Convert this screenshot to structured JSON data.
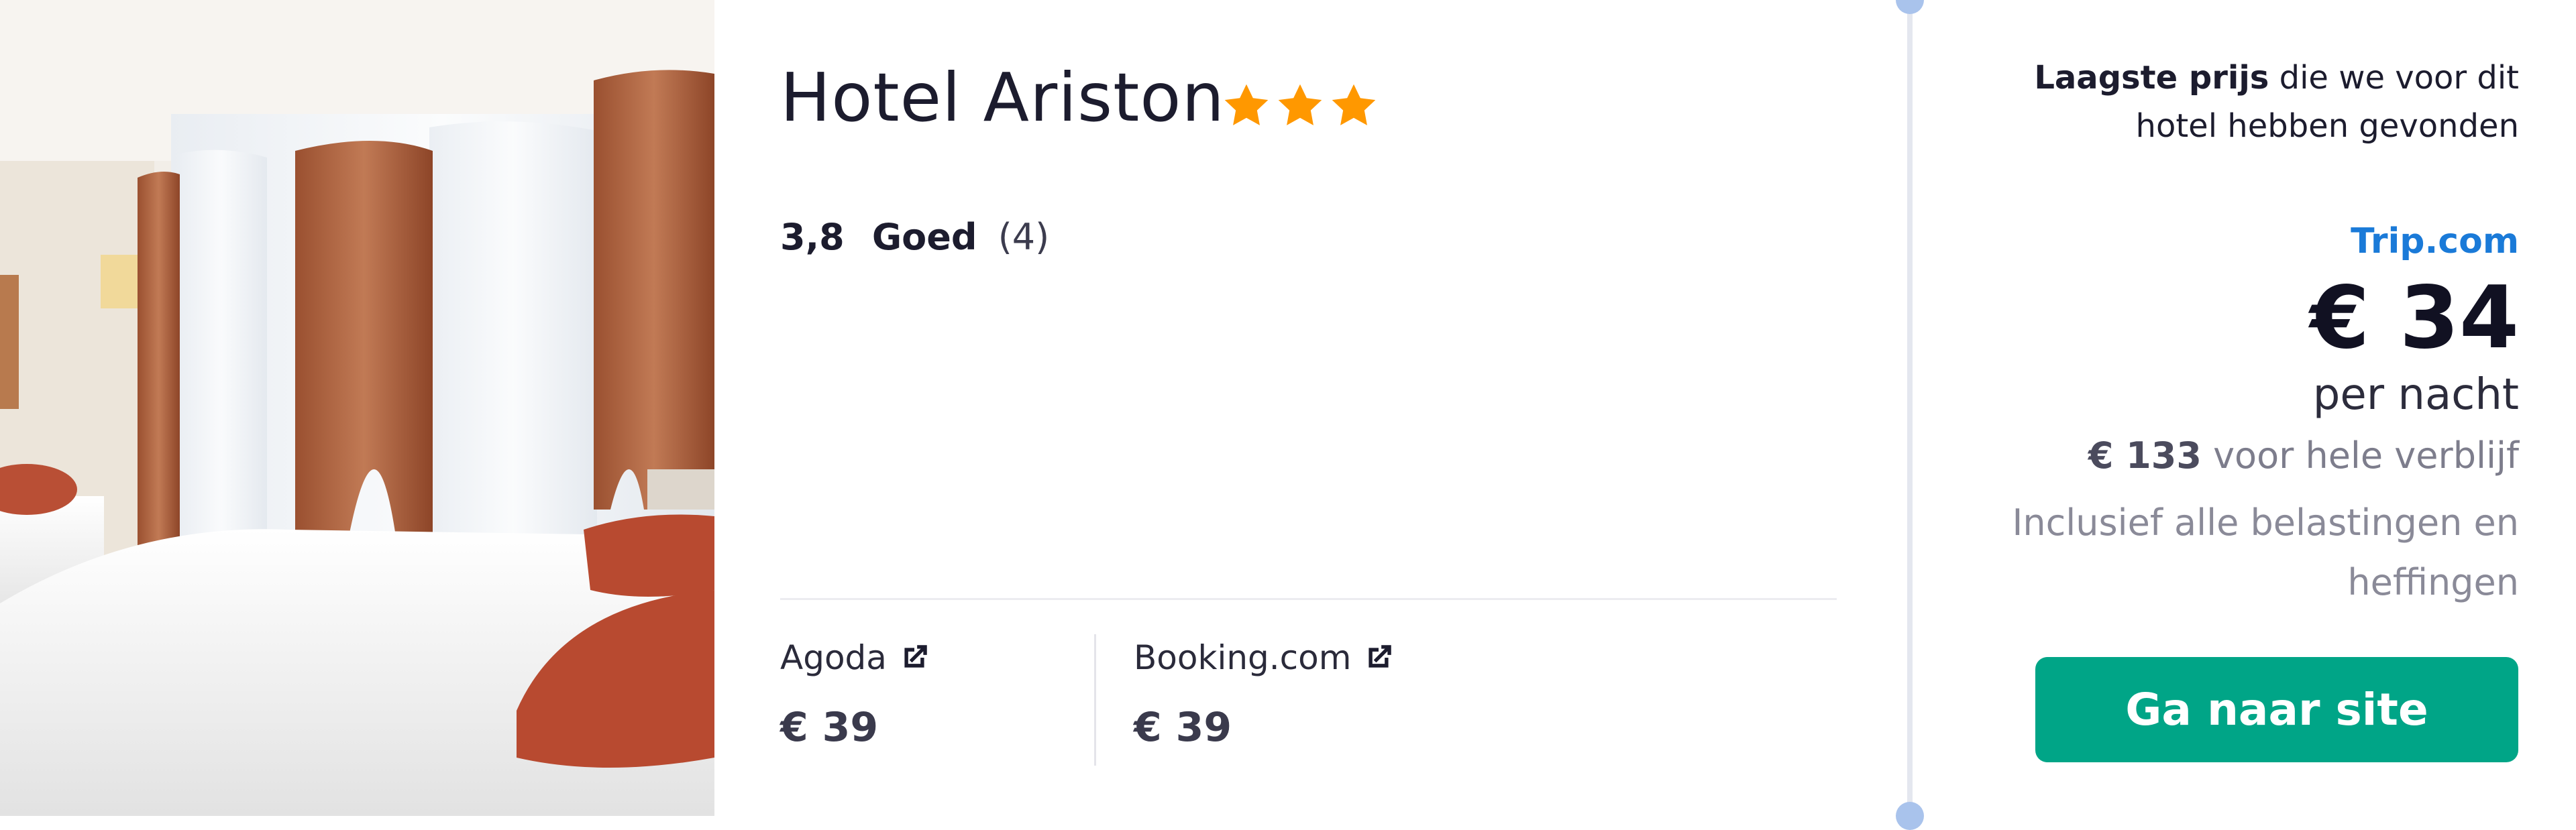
{
  "hotel": {
    "name": "Hotel Ariston",
    "star_count": 3,
    "rating": {
      "score": "3,8",
      "label": "Goed",
      "count": "(4)"
    }
  },
  "providers": [
    {
      "name": "Agoda",
      "price": "€ 39",
      "icon": "external-link-icon"
    },
    {
      "name": "Booking.com",
      "price": "€ 39",
      "icon": "external-link-icon"
    }
  ],
  "deal": {
    "lowest_label_bold": "Laagste prijs",
    "lowest_label_rest": " die we voor dit hotel hebben gevonden",
    "site": "Trip.com",
    "price": "€ 34",
    "per_night": "per nacht",
    "total_amount": "€ 133",
    "total_label": " voor hele verblijf",
    "taxes_note": "Inclusief alle belastingen en heffingen",
    "cta_label": "Ga naar site"
  },
  "colors": {
    "star": "#FF9800",
    "site_link": "#1A7AD8",
    "cta_background": "#00A587",
    "timeline_dot": "#A9C3EC"
  }
}
